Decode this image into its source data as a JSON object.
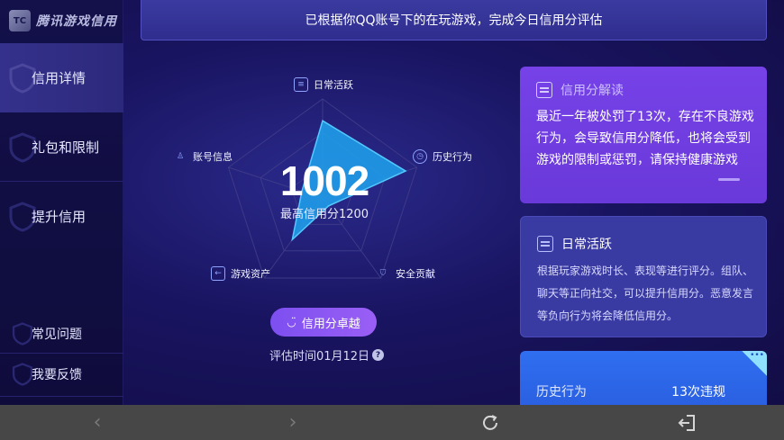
{
  "app": {
    "name": "腾讯游戏信用",
    "logo_mark": "TC"
  },
  "sidebar": {
    "items": [
      {
        "label": "信用详情",
        "active": true
      },
      {
        "label": "礼包和限制",
        "active": false
      },
      {
        "label": "提升信用",
        "active": false
      }
    ],
    "footer_items": [
      {
        "label": "常见问题"
      },
      {
        "label": "我要反馈"
      }
    ]
  },
  "banner": {
    "text": "已根据你QQ账号下的在玩游戏，完成今日信用分评估"
  },
  "credit": {
    "score": "1002",
    "max_label": "最高信用分1200",
    "grade": "信用分卓越",
    "eval_time": "评估时间01月12日",
    "help_icon": "?",
    "axes": [
      {
        "label": "日常活跃",
        "icon": "doc-icon",
        "value": 0.78
      },
      {
        "label": "历史行为",
        "icon": "clock-icon",
        "value": 0.88
      },
      {
        "label": "安全贡献",
        "icon": "shield-icon",
        "value": 0.1
      },
      {
        "label": "游戏资产",
        "icon": "wallet-icon",
        "value": 0.52
      },
      {
        "label": "账号信息",
        "icon": "user-icon",
        "value": 0.22
      }
    ]
  },
  "cards": {
    "interpret": {
      "title": "信用分解读",
      "body": "最近一年被处罚了13次，存在不良游戏行为，会导致信用分降低，也将会受到游戏的限制或惩罚，请保持健康游戏"
    },
    "daily": {
      "title": "日常活跃",
      "body": "根据玩家游戏时长、表现等进行评分。组队、聊天等正向社交，可以提升信用分。恶意发言等负向行为将会降低信用分。"
    },
    "history": {
      "key": "历史行为",
      "value": "13次违规",
      "corner": "•••"
    }
  },
  "colors": {
    "accent": "#7d4ff0",
    "radar_fill": "#1fa3ee",
    "card_purple": "#7642e8",
    "card_blue": "#2f6ff0"
  }
}
